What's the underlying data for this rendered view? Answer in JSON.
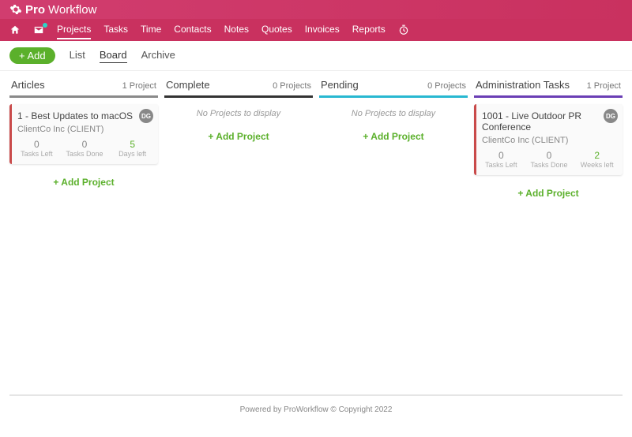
{
  "brand": {
    "bold": "Pro",
    "thin": "Workflow"
  },
  "mainnav": {
    "items": [
      {
        "label": "Projects",
        "active": true
      },
      {
        "label": "Tasks",
        "active": false
      },
      {
        "label": "Time",
        "active": false
      },
      {
        "label": "Contacts",
        "active": false
      },
      {
        "label": "Notes",
        "active": false
      },
      {
        "label": "Quotes",
        "active": false
      },
      {
        "label": "Invoices",
        "active": false
      },
      {
        "label": "Reports",
        "active": false
      }
    ]
  },
  "subnav": {
    "add_label": "+ Add",
    "items": [
      {
        "label": "List",
        "active": false
      },
      {
        "label": "Board",
        "active": true
      },
      {
        "label": "Archive",
        "active": false
      }
    ]
  },
  "board": {
    "columns": [
      {
        "key": "articles",
        "title": "Articles",
        "count": "1 Project",
        "empty_msg": null,
        "cards": [
          {
            "title": "1 - Best Updates to macOS",
            "client": "ClientCo Inc (CLIENT)",
            "avatar": "DG",
            "stats": [
              {
                "value": "0",
                "label": "Tasks Left",
                "green": false
              },
              {
                "value": "0",
                "label": "Tasks Done",
                "green": false
              },
              {
                "value": "5",
                "label": "Days left",
                "green": true
              }
            ]
          }
        ]
      },
      {
        "key": "complete",
        "title": "Complete",
        "count": "0 Projects",
        "empty_msg": "No Projects to display",
        "cards": []
      },
      {
        "key": "pending",
        "title": "Pending",
        "count": "0 Projects",
        "empty_msg": "No Projects to display",
        "cards": []
      },
      {
        "key": "admin",
        "title": "Administration Tasks",
        "count": "1 Project",
        "empty_msg": null,
        "cards": [
          {
            "title": "1001 - Live Outdoor PR Conference",
            "client": "ClientCo Inc (CLIENT)",
            "avatar": "DG",
            "stats": [
              {
                "value": "0",
                "label": "Tasks Left",
                "green": false
              },
              {
                "value": "0",
                "label": "Tasks Done",
                "green": false
              },
              {
                "value": "2",
                "label": "Weeks left",
                "green": true
              }
            ]
          }
        ]
      }
    ],
    "add_project_label": "+ Add Project"
  },
  "footer": "Powered by ProWorkflow © Copyright 2022"
}
